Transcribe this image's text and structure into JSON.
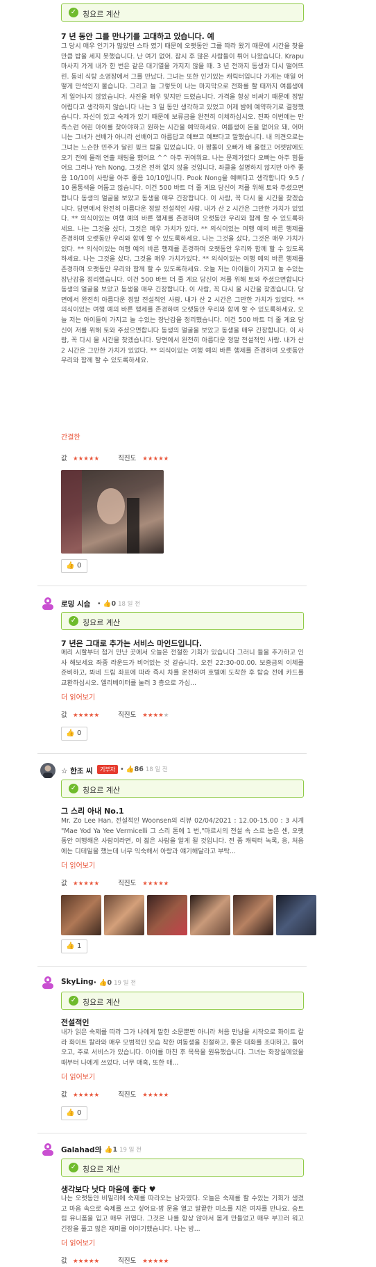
{
  "verified_label": "칭요르 계산",
  "more_label": "더 읽어보기",
  "value_label": "값",
  "honesty_label": "직진도",
  "reviews": [
    {
      "title": "7 년 동안 그를 만나기를 고대하고 있습니다. 예",
      "body": "그 당시 매우 인기가 많았던 스타 였기 때문에 오랫동안 그를 따라 왔기 때문에 시간을 찾을만큼 밥을 세지 못했습니다. 난 여기 없어. 잠시 후 많은 사람들이 튀어 나왔습니다. Krapu 마사지 가게 내가 한 번은 같은 대기열을 가지지 않을 때. 3 년 전까지 동생과 다시 떨어뜨린. 동네 식탕 소영장에서 그를 만났다. 그녀는 또한 인기있는 캐릭터입니다 가게는 매일 어떻게 만석인지 몰습니다. 그리고 늘 그렇듯이 나는 마지막으로 전화를 할 때까지 여름생에게 일어나지 않았습니다. 사진을 매우 맞지만 드렸습니다. 가격을 항상 비싸기 때문에 정말 어렵다고 생각하지 않습니다 나는 3 일 동안 생각하고 있었고 어제 밤에 예약하기로 결정했습니다. 자신이 있고 숙제가 있기 때문에 보류금을 완전히 이체하십시오. 진짜 이번에는 만족스런 어린 아이를 찾아야하고 원하는 시간을 예약하세요. 여름생이 돈을 없어요 돼, 어머니는 그녀가 선배가 아니라 선배이고 아름답고 예쁘고 예쁘다고 말했습니다. 내 의견으로는 그녀는 느슨한 민주가 달린 핑크 탑을 입었습니다. 아 짱돌이 오빠가 배 올렸고 어젯밤에도 오기 전에 몰래 연출 채팅을 했어요 ^^ 아주 귀여워요. 나는 문제가있다 오빠는 아주 힘들어요 그러나 Yeh Nong, 그것은 전혀 없지 않을 것입니다. 좌클을 설명하지 않지만 아주 좋음 10/10이 사랑을 아주 좋음 10/10입니다. Pook Nong을 예뻐다고 생각합니다 9.5 / 10 몸통색을 어둡고 않습니다. 이건 500 바트 더 줄 게요 당신이 저를 위해 토와 주셨으면 합니다 동생의 얼굴을 보았고 동생을 매우 긴장합니다. 이 사람, 꼭 다시 올 시간을 찾겠습니다. 당면에서 완전히 아름다운 정말 전설적인 사람. 내가 산 2 시간은 그만한 가치가 있었다. ** 의식이있는 여행 예의 바른 행제를 존경하며 오랫동안 우리와 함께 할 수 있도록하세요. 나는 그것을 샀다, 그것은 매우 가치가 있다. ** 의식이있는 여행 예의 바른 행제를 존경하며 오랫동안 우리와 함께 할 수 있도록하세요. 나는 그것을 샀다, 그것은 매우 가치가 있다. ** 의식이있는 여행 예의 바른 행제를 존경하며 오랫동안 우리와 함께 할 수 있도록하세요. 나는 그것을 샀다, 그것을 매우 가치가있다. ** 의식이있는 여행 예의 바른 행제를 존경하며 오랫동안 우리와 함께 할 수 있도록하세요. 오늘 저는 아이들이 가지고 놀 수있는 장난감을 정리했습니다. 이건 500 바트 더 줄 게요 당신이 저를 위해 토와 주셨으면합니다 동생의 얼굴을 보았고 동생을 매우 긴장합니다. 이 사람, 꼭 다시 올 시간을 찾겠습니다. 당면에서 완전히 아름다운 정말 전설적인 사람. 내가 산 2 시간은 그만한 가치가 있었다. ** 의식이있는 여행 예의 바른 행제를 존경하며 오랫동안 우리와 함께 할 수 있도록하세요. 오늘 저는 아이들이 가지고 놀 수있는 장난감을 정리했습니다. 이건 500 바트 더 줄 게요 당신이 저를 위해 토와 주셨으면합니다 동생의 얼굴을 보았고 동생을 매우 긴장합니다. 이 사람, 꼭 다시 올 시간을 찾겠습니다. 당면에서 완전히 아름다운 정말 전설적인 사람. 내가 산 2 시간은 그만한 가치가 있었다. ** 의식이있는 여행 예의 바른 행제를 존경하며 오랫동안 우리와 함께 할 수 있도록하세요.",
      "less_label": "간결한",
      "value_stars": 5,
      "honesty_stars": 5,
      "likes": "0"
    },
    {
      "user": "로밍 시슴",
      "likes_meta": "0",
      "date": "18 일 전",
      "title": "7 년은 그대로 추가는 서비스 마인드입니다.",
      "body": "메리 시할부터 첨거 만난 곳에서 오늘은 전절한 기회가 있습니다 그러니 들을 추가하고 인사 해보세요 좌종 라운드가 비어있는 것 같습니다. 오전 22:30-00.00. 보증금의 이체를 준비하고, 봐네 드림 좌표에 따라 즉시 차를 운전하여 호텔에 도착한 후 탑승 전에 카드를 교환하십시오. 엘리베이터를 눌러 3 층으로 가십...",
      "value_stars": 5,
      "honesty_stars": 4,
      "likes": "0"
    },
    {
      "user": "☆ 한조 씨",
      "tag": "기부자",
      "likes_meta": "86",
      "date": "18 일 전",
      "title": "그 스리 아내 No.1",
      "body": "Mr. Zo Lee Han, 전설적인 Woonsen의 리뷰 02/04/2021 : 12.00-15.00 : 3 시계 \"Mae Yod Ya Yee Vermicelli 그 스리 톤에 1 번,\"마르시의 전설 속 스르 농은 센, 오랫동안 여행해온 사람이라면, 이 젊은 사람을 알게 될 것입니다. 전 좀 캐릭터 녹록, 응, 처음에는 디테일을 했는데 너무 익숙해서 아랑과 얘기해달라고 부탁...",
      "value_stars": 5,
      "honesty_stars": 5,
      "likes": "1"
    },
    {
      "user": "SkyLing",
      "likes_meta": "0",
      "date": "19 일 전",
      "title": "전설적인",
      "body": "내가 읽은 숙제를 따라 그가 나에게 말한 소문뿐만 아니라 처음 만남을 시작으로 화이트 칼라 화이트 칼라와 매우 모범적인 모습 착한 여동생을 친절하고, 좋은 대화를 조대하고, 들어오고, 주로 서비스가 있습니다. 아이를 마친 후 목욕을 원유했습니다. 그녀는 화장실에있을 때부터 나에게 쓰었다. 너무 매혹, 또한 매...",
      "value_stars": 5,
      "honesty_stars": 5,
      "likes": "0"
    },
    {
      "user": "Galahad의",
      "likes_meta": "1",
      "date": "19 일 전",
      "title": "생각보다 낫다 마음에 좋다 ♥",
      "body": "나는 오랫동안 비밀리에 숙제를 따라오는 남자였다. 오늘은 숙제를 할 수있는 기회가 생겼고 마음 속으로 숙제를 쓰고 싶어요-방 문을 열고 말끝한 미소를 지은 여자를 만나요. 승트림 유니폼을 입고 매우 귀엽다. 그것은 나를 항상 앉아서 몸게 만들었고 매우 부끄러 워고 긴장을 풀고 많은 재미를 이야기했습니다. 나는 방...",
      "value_stars": 5,
      "honesty_stars": 5
    }
  ]
}
